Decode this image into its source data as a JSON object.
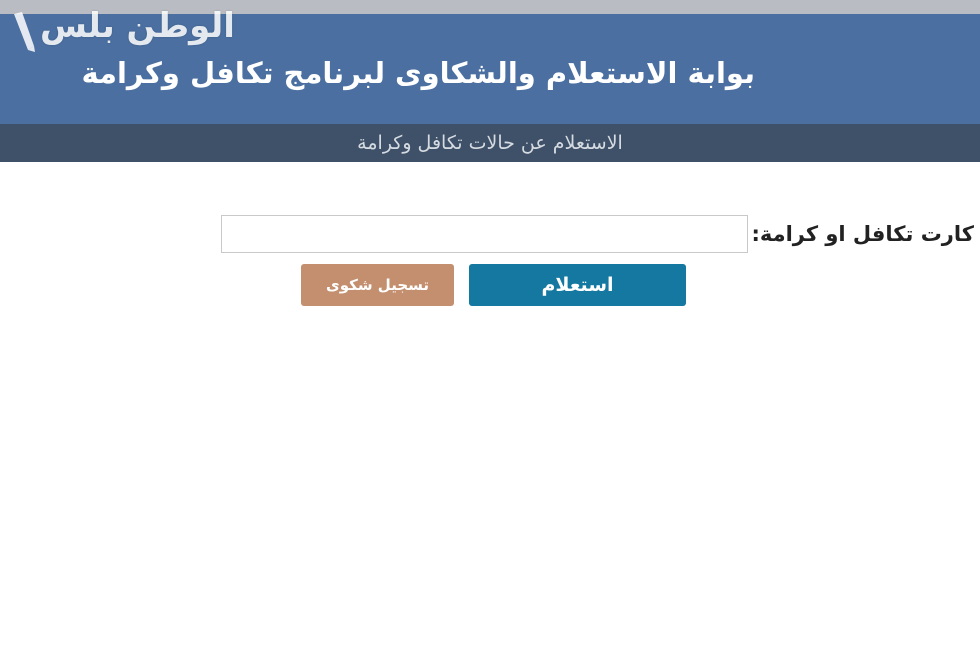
{
  "watermark": {
    "text": "الوطن بلس"
  },
  "header": {
    "title": "بوابة الاستعلام والشكاوى لبرنامج تكافل وكرامة",
    "subtitle": "الاستعلام عن حالات تكافل وكرامة"
  },
  "form": {
    "card_label": "كارت تكافل او كرامة:",
    "card_value": "",
    "card_placeholder": ""
  },
  "buttons": {
    "inquire_label": "استعلام",
    "complaint_label": "تسجيل شكوى"
  },
  "colors": {
    "header_bg": "#4a6fa0",
    "subheader_bg": "#3e5169",
    "inquire_button": "#1478a0",
    "complaint_button": "#c48f6f"
  }
}
